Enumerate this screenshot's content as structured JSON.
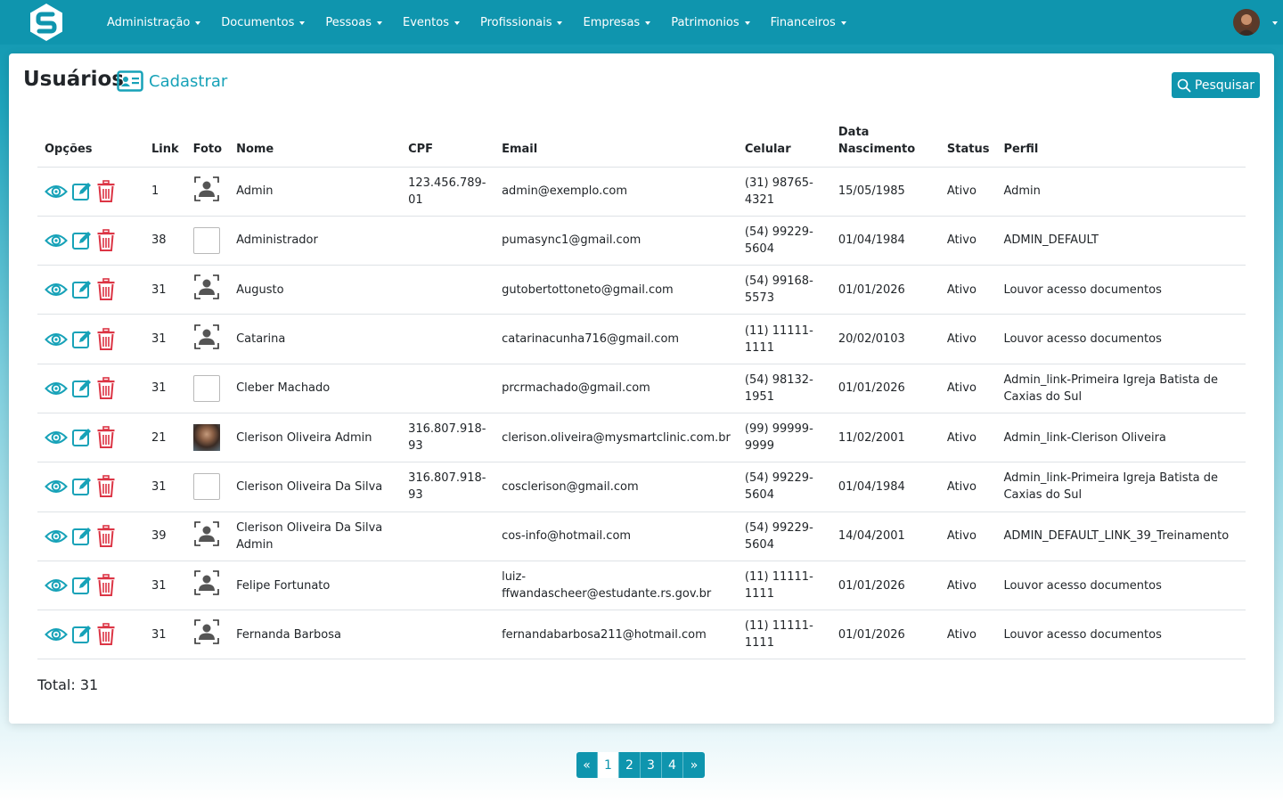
{
  "nav": {
    "items": [
      "Administração",
      "Documentos",
      "Pessoas",
      "Eventos",
      "Profissionais",
      "Empresas",
      "Patrimonios",
      "Financeiros"
    ]
  },
  "page": {
    "title": "Usuários",
    "register_label": "Cadastrar",
    "search_label": "Pesquisar"
  },
  "table": {
    "headers": {
      "options": "Opções",
      "link": "Link",
      "photo": "Foto",
      "name": "Nome",
      "cpf": "CPF",
      "email": "Email",
      "phone": "Celular",
      "birth": "Data Nascimento",
      "status": "Status",
      "profile": "Perfil"
    },
    "rows": [
      {
        "link": "1",
        "photo": "placeholder",
        "name": "Admin",
        "cpf": "123.456.789-01",
        "email": "admin@exemplo.com",
        "phone": "(31) 98765-4321",
        "birth": "15/05/1985",
        "status": "Ativo",
        "profile": "Admin"
      },
      {
        "link": "38",
        "photo": "broken",
        "name": "Administrador",
        "cpf": "",
        "email": "pumasync1@gmail.com",
        "phone": "(54) 99229-5604",
        "birth": "01/04/1984",
        "status": "Ativo",
        "profile": "ADMIN_DEFAULT"
      },
      {
        "link": "31",
        "photo": "placeholder",
        "name": "Augusto",
        "cpf": "",
        "email": "gutobertottoneto@gmail.com",
        "phone": "(54) 99168-5573",
        "birth": "01/01/2026",
        "status": "Ativo",
        "profile": "Louvor acesso documentos"
      },
      {
        "link": "31",
        "photo": "placeholder",
        "name": "Catarina",
        "cpf": "",
        "email": "catarinacunha716@gmail.com",
        "phone": "(11) 11111-1111",
        "birth": "20/02/0103",
        "status": "Ativo",
        "profile": "Louvor acesso documentos"
      },
      {
        "link": "31",
        "photo": "broken",
        "name": "Cleber Machado",
        "cpf": "",
        "email": "prcrmachado@gmail.com",
        "phone": "(54) 98132-1951",
        "birth": "01/01/2026",
        "status": "Ativo",
        "profile": "Admin_link-Primeira Igreja Batista de Caxias do Sul"
      },
      {
        "link": "21",
        "photo": "real",
        "name": "Clerison Oliveira Admin",
        "cpf": "316.807.918-93",
        "email": "clerison.oliveira@mysmartclinic.com.br",
        "phone": "(99) 99999-9999",
        "birth": "11/02/2001",
        "status": "Ativo",
        "profile": "Admin_link-Clerison Oliveira"
      },
      {
        "link": "31",
        "photo": "broken",
        "name": "Clerison Oliveira Da Silva",
        "cpf": "316.807.918-93",
        "email": "cosclerison@gmail.com",
        "phone": "(54) 99229-5604",
        "birth": "01/04/1984",
        "status": "Ativo",
        "profile": "Admin_link-Primeira Igreja Batista de Caxias do Sul"
      },
      {
        "link": "39",
        "photo": "placeholder",
        "name": "Clerison Oliveira Da Silva Admin",
        "cpf": "",
        "email": "cos-info@hotmail.com",
        "phone": "(54) 99229-5604",
        "birth": "14/04/2001",
        "status": "Ativo",
        "profile": "ADMIN_DEFAULT_LINK_39_Treinamento"
      },
      {
        "link": "31",
        "photo": "placeholder",
        "name": "Felipe Fortunato",
        "cpf": "",
        "email": "luiz-ffwandascheer@estudante.rs.gov.br",
        "phone": "(11) 11111-1111",
        "birth": "01/01/2026",
        "status": "Ativo",
        "profile": "Louvor acesso documentos"
      },
      {
        "link": "31",
        "photo": "placeholder",
        "name": "Fernanda Barbosa",
        "cpf": "",
        "email": "fernandabarbosa211@hotmail.com",
        "phone": "(11) 11111-1111",
        "birth": "01/01/2026",
        "status": "Ativo",
        "profile": "Louvor acesso documentos"
      }
    ]
  },
  "total_label": "Total: 31",
  "pagination": {
    "prev": "«",
    "pages": [
      "1",
      "2",
      "3",
      "4"
    ],
    "current": "1",
    "next": "»"
  },
  "colors": {
    "primary": "#0f95ae",
    "icon_teal": "#17a2b8",
    "delete_red": "#dc3545"
  }
}
